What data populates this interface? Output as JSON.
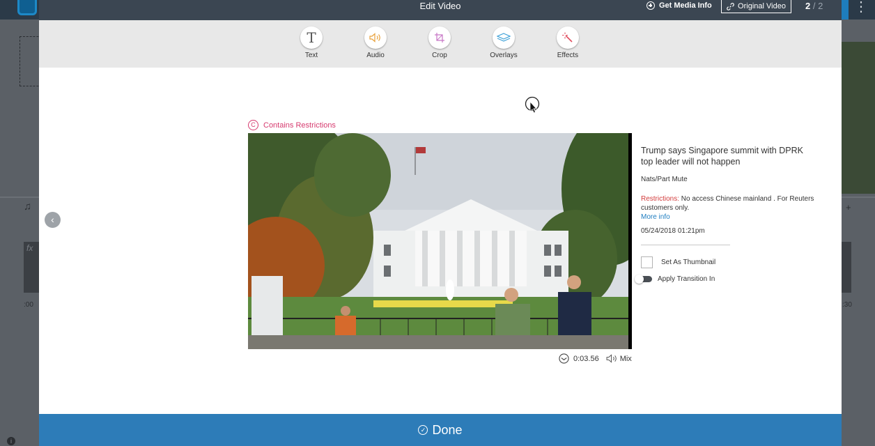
{
  "header": {
    "title": "Edit Video",
    "get_media_info": "Get Media Info",
    "original_video": "Original Video",
    "pager_current": "2",
    "pager_total": " / 2"
  },
  "toolbar": {
    "tools": [
      {
        "label": "Text",
        "icon": "text-icon"
      },
      {
        "label": "Audio",
        "icon": "audio-icon"
      },
      {
        "label": "Crop",
        "icon": "crop-icon"
      },
      {
        "label": "Overlays",
        "icon": "overlays-icon"
      },
      {
        "label": "Effects",
        "icon": "effects-icon"
      }
    ]
  },
  "video": {
    "restriction_note": "Contains Restrictions",
    "duration": "0:03.56",
    "audio_mode": "Mix"
  },
  "info": {
    "title": "Trump says Singapore summit with DPRK top leader will not happen",
    "subtitle": "Nats/Part Mute",
    "restrictions_label": "Restrictions:",
    "restrictions_text": " No access Chinese mainland . For Reuters customers only.",
    "more_info": "More info",
    "date": "05/24/2018 01:21pm",
    "set_thumbnail": "Set As Thumbnail",
    "apply_transition": "Apply Transition In"
  },
  "footer": {
    "done_label": "Done"
  },
  "background": {
    "time_start": ":00",
    "time_end": ":30"
  },
  "colors": {
    "header_bg": "#3b4652",
    "done_bar": "#2d7cb8",
    "restriction_accent": "#d63a6e",
    "link": "#1e7dc0"
  }
}
